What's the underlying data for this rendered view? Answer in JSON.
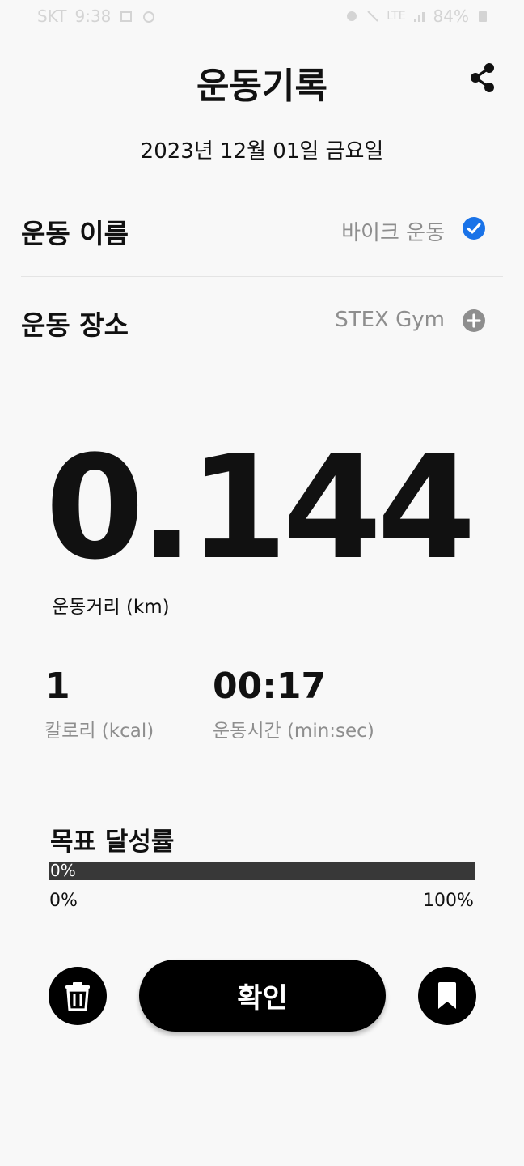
{
  "status_bar": {
    "carrier": "SKT",
    "time": "9:38",
    "battery": "84%",
    "network": "LTE"
  },
  "header": {
    "title": "운동기록"
  },
  "date": "2023년 12월 01일 금요일",
  "rows": {
    "name": {
      "label": "운동 이름",
      "value": "바이크 운동",
      "icon": "check-circle-icon",
      "icon_color": "#1a73e8"
    },
    "location": {
      "label": "운동 장소",
      "value": "STEX Gym",
      "icon": "plus-circle-icon",
      "icon_color": "#8e8e8e"
    }
  },
  "distance": {
    "value": "0.144",
    "label": "운동거리 (km)"
  },
  "stats": {
    "calories": {
      "value": "1",
      "label": "칼로리 (kcal)"
    },
    "time": {
      "value": "00:17",
      "label": "운동시간 (min:sec)"
    }
  },
  "goal": {
    "title": "목표 달성률",
    "progress": 0,
    "progress_label": "0%",
    "min_label": "0%",
    "max_label": "100%"
  },
  "actions": {
    "confirm_label": "확인",
    "delete_icon": "trash-icon",
    "bookmark_icon": "bookmark-icon"
  }
}
